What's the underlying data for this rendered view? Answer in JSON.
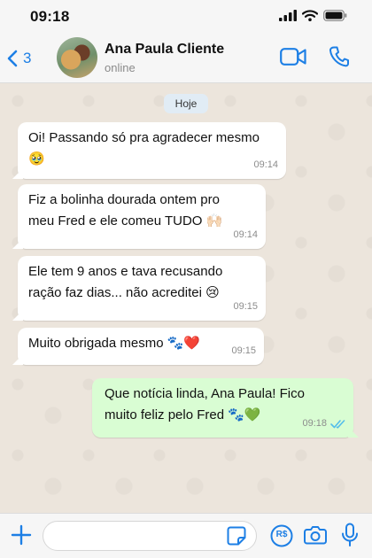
{
  "status_bar": {
    "time": "09:18"
  },
  "header": {
    "back_count": "3",
    "contact_name": "Ana Paula Cliente",
    "contact_status": "online"
  },
  "chat": {
    "date_label": "Hoje",
    "messages": [
      {
        "direction": "in",
        "text": "Oi! Passando só pra agradecer mesmo\n🥹",
        "time": "09:14"
      },
      {
        "direction": "in",
        "text": "Fiz a bolinha dourada ontem pro\nmeu Fred e ele comeu TUDO 🙌🏻",
        "time": "09:14"
      },
      {
        "direction": "in",
        "text": "Ele tem 9 anos e tava recusando\nração faz dias... não acreditei 😢",
        "time": "09:15"
      },
      {
        "direction": "in",
        "text": "Muito obrigada mesmo 🐾❤️",
        "time": "09:15"
      },
      {
        "direction": "out",
        "text": "Que notícia linda, Ana Paula! Fico\nmuito feliz pelo Fred 🐾💚",
        "time": "09:18",
        "status": "read"
      }
    ]
  },
  "input": {
    "placeholder": "",
    "value": "",
    "pay_label": "R$"
  },
  "icons": {
    "back": "chevron-left-icon",
    "video": "video-camera-icon",
    "phone": "phone-icon",
    "plus": "plus-icon",
    "sticker": "sticker-icon",
    "pay": "payment-icon",
    "camera": "camera-icon",
    "mic": "microphone-icon",
    "read": "double-check-icon"
  },
  "colors": {
    "accent": "#1d7fe5",
    "outgoing_bubble": "#d9fdd3",
    "incoming_bubble": "#ffffff",
    "chat_background": "#ece5dc",
    "read_ticks": "#53bdeb"
  }
}
